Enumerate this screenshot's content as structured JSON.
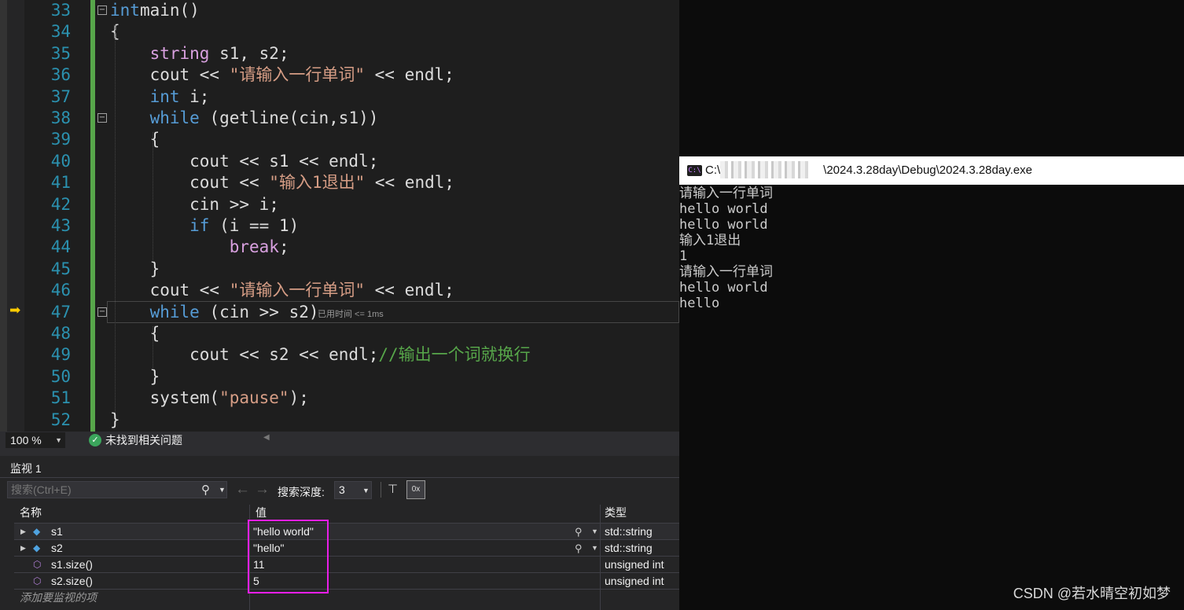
{
  "editor": {
    "lines": [
      {
        "n": "33",
        "tokens": [
          [
            "k",
            "int"
          ],
          [
            "",
            "main()"
          ]
        ]
      },
      {
        "n": "34",
        "tokens": [
          [
            "",
            "{"
          ]
        ]
      },
      {
        "n": "35",
        "tokens": [
          [
            "",
            "    "
          ],
          [
            "c",
            "string"
          ],
          [
            "",
            " s1, s2;"
          ]
        ]
      },
      {
        "n": "36",
        "tokens": [
          [
            "",
            "    cout << "
          ],
          [
            "s",
            "\"请输入一行单词\""
          ],
          [
            "",
            " << endl;"
          ]
        ]
      },
      {
        "n": "37",
        "tokens": [
          [
            "",
            "    "
          ],
          [
            "k",
            "int"
          ],
          [
            "",
            " i;"
          ]
        ]
      },
      {
        "n": "38",
        "tokens": [
          [
            "",
            "    "
          ],
          [
            "k",
            "while"
          ],
          [
            "",
            " (getline(cin,s1))"
          ]
        ]
      },
      {
        "n": "39",
        "tokens": [
          [
            "",
            "    {"
          ]
        ]
      },
      {
        "n": "40",
        "tokens": [
          [
            "",
            "        cout << s1 << endl;"
          ]
        ]
      },
      {
        "n": "41",
        "tokens": [
          [
            "",
            "        cout << "
          ],
          [
            "s",
            "\"输入1退出\""
          ],
          [
            "",
            " << endl;"
          ]
        ]
      },
      {
        "n": "42",
        "tokens": [
          [
            "",
            "        cin >> i;"
          ]
        ]
      },
      {
        "n": "43",
        "tokens": [
          [
            "",
            "        "
          ],
          [
            "k",
            "if"
          ],
          [
            "",
            " (i == 1)"
          ]
        ]
      },
      {
        "n": "44",
        "tokens": [
          [
            "",
            "            "
          ],
          [
            "c",
            "break"
          ],
          [
            "",
            ";"
          ]
        ]
      },
      {
        "n": "45",
        "tokens": [
          [
            "",
            "    }"
          ]
        ]
      },
      {
        "n": "46",
        "tokens": [
          [
            "",
            "    cout << "
          ],
          [
            "s",
            "\"请输入一行单词\""
          ],
          [
            "",
            " << endl;"
          ]
        ]
      },
      {
        "n": "47",
        "tokens": [
          [
            "",
            "    "
          ],
          [
            "k",
            "while"
          ],
          [
            "",
            " (cin >> s2)"
          ]
        ]
      },
      {
        "n": "48",
        "tokens": [
          [
            "",
            "    {"
          ]
        ]
      },
      {
        "n": "49",
        "tokens": [
          [
            "",
            "        cout << s2 << endl;"
          ],
          [
            "cm",
            "//输出一个词就换行"
          ]
        ]
      },
      {
        "n": "50",
        "tokens": [
          [
            "",
            "    }"
          ]
        ]
      },
      {
        "n": "51",
        "tokens": [
          [
            "",
            "    system("
          ],
          [
            "s",
            "\"pause\""
          ],
          [
            "",
            ");"
          ]
        ]
      },
      {
        "n": "52",
        "tokens": [
          [
            "",
            "}"
          ]
        ]
      }
    ],
    "elapsed_hint": "已用时间 <= 1ms"
  },
  "status": {
    "zoom": "100 %",
    "issues": "未找到相关问题"
  },
  "watch": {
    "title": "监视 1",
    "search_placeholder": "搜索(Ctrl+E)",
    "depth_label": "搜索深度:",
    "depth_value": "3",
    "hex_label": "0x",
    "columns": {
      "name": "名称",
      "value": "值",
      "type": "类型"
    },
    "rows": [
      {
        "name": "s1",
        "value": "\"hello world\"",
        "type": "std::string"
      },
      {
        "name": "s2",
        "value": "\"hello\"",
        "type": "std::string"
      },
      {
        "name": "s1.size()",
        "value": "11",
        "type": "unsigned int"
      },
      {
        "name": "s2.size()",
        "value": "5",
        "type": "unsigned int"
      }
    ],
    "add_item": "添加要监视的项"
  },
  "console": {
    "icon_text": "C:\\",
    "title_prefix": "C:\\",
    "title_suffix": "\\2024.3.28day\\Debug\\2024.3.28day.exe",
    "lines": [
      "请输入一行单词",
      "hello world",
      "hello world",
      "输入1退出",
      "1",
      "请输入一行单词",
      "hello world",
      "hello"
    ]
  },
  "watermark": "CSDN @若水晴空初如梦",
  "colors": {
    "highlight": "#e81fe8",
    "change_bar": "#57a64a",
    "exec_arrow": "#ffcc00"
  }
}
